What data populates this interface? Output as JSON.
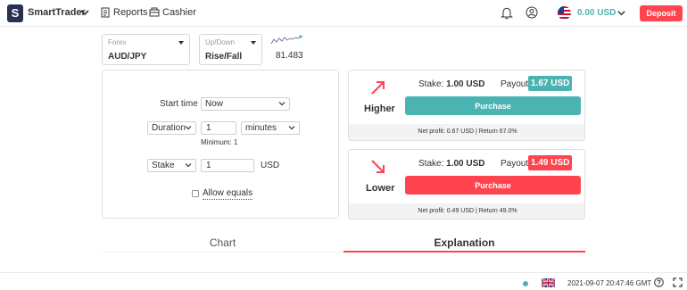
{
  "header": {
    "logo_letter": "S",
    "brand": "SmartTrader",
    "nav": {
      "reports": "Reports",
      "cashier": "Cashier"
    },
    "balance": "0.00 USD",
    "deposit_label": "Deposit",
    "icons": [
      "chevron-down-icon",
      "reports-icon",
      "cashier-icon",
      "bell-icon",
      "user-icon",
      "us-flag-icon"
    ]
  },
  "market": {
    "caption": "Forex",
    "value": "AUD/JPY"
  },
  "trade_type": {
    "caption": "Up/Down",
    "value": "Rise/Fall"
  },
  "spot": "81.483",
  "params": {
    "start_time_label": "Start time",
    "start_time_value": "Now",
    "duration_type": "Duration",
    "duration_value": "1",
    "duration_unit": "minutes",
    "minimum_hint": "Minimum: 1",
    "amount_type": "Stake",
    "amount_value": "1",
    "currency": "USD",
    "allow_equals": "Allow equals"
  },
  "higher": {
    "title": "Higher",
    "stake_label": "Stake:",
    "stake_value": "1.00 USD",
    "payout_label": "Payout:",
    "payout_value": "1.67 USD",
    "purchase_label": "Purchase",
    "net": "Net profit: 0.67 USD | Return 67.0%"
  },
  "lower": {
    "title": "Lower",
    "stake_label": "Stake:",
    "stake_value": "1.00 USD",
    "payout_label": "Payout:",
    "payout_value": "1.49 USD",
    "purchase_label": "Purchase",
    "net": "Net profit: 0.49 USD | Return 49.0%"
  },
  "tabs": {
    "chart": "Chart",
    "explanation": "Explanation",
    "active": "Explanation"
  },
  "footer": {
    "time": "2021-09-07 20:47:46 GMT"
  },
  "colors": {
    "accent": "#4bb4b3",
    "danger": "#ff444f",
    "brand": "#2a3052"
  }
}
